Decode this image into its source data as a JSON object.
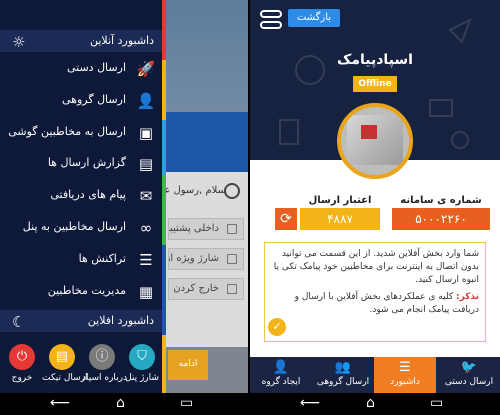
{
  "left": {
    "background": {
      "greeting": "سلام ,رسول عزیز",
      "rows": [
        "داخلی پشتیبانی",
        "شارژ ویژه از",
        "خارج کردن"
      ],
      "orange_button": "ادامه"
    },
    "online_header": "داشبورد آنلاین",
    "offline_header": "داشبورد افلاین",
    "menu": [
      {
        "label": "ارسال دستی",
        "icon": "rocket-icon",
        "glyph": "🚀"
      },
      {
        "label": "ارسال گروهی",
        "icon": "person-icon",
        "glyph": "👤"
      },
      {
        "label": "ارسال به مخاطبین گوشی",
        "icon": "contact-card-icon",
        "glyph": "▣"
      },
      {
        "label": "گزارش ارسال ها",
        "icon": "report-icon",
        "glyph": "▤"
      },
      {
        "label": "پیام های دریافتی",
        "icon": "envelope-icon",
        "glyph": "✉"
      },
      {
        "label": "ارسال مخاطبین به پنل",
        "icon": "infinity-icon",
        "glyph": "∞"
      },
      {
        "label": "تراکنش ها",
        "icon": "list-icon",
        "glyph": "☰"
      },
      {
        "label": "مدیریت مخاطبین",
        "icon": "document-icon",
        "glyph": "▦"
      }
    ],
    "bottom": [
      {
        "label": "شارژ پنل",
        "icon": "bag-icon",
        "color": "#27a9c4",
        "glyph": "⛉"
      },
      {
        "label": "درباره اسپاد",
        "icon": "info-icon",
        "color": "#7a7a7a",
        "glyph": "ⓘ"
      },
      {
        "label": "ارسال تیکت",
        "icon": "ticket-icon",
        "color": "#f2b418",
        "glyph": "▤"
      },
      {
        "label": "خروج",
        "icon": "power-icon",
        "color": "#e53935",
        "glyph": "⏻"
      }
    ],
    "strip_colors": [
      "#e53935",
      "#f2b418",
      "#2e9fe0",
      "#43b649",
      "#1e57a8",
      "#f2b418"
    ]
  },
  "right": {
    "back_label": "بازگشت",
    "title": "اسپادپیامک",
    "status": "Offline",
    "stats": [
      {
        "label": "شماره ی سامانه",
        "value": "۵۰۰۰۲۲۶۰",
        "color": "#e8601f"
      },
      {
        "label": "اعتبار ارسال",
        "value": "۴۸۸۷",
        "color": "#f2b418"
      }
    ],
    "notice_text": "شما وارد بخش آفلاین شدید. از این قسمت می توانید بدون اتصال به اینترنت برای مخاطبین خود پیامک تکی یا انبوه ارسال کنید.",
    "notice_warn_label": "تذکر:",
    "notice_warn_text": "کلیه ی عملکردهای بخش آفلاین با ارسال و دریافت پیامک انجام می شود.",
    "tabs": [
      {
        "label": "ایجاد گروه",
        "icon": "person-add-icon",
        "glyph": "👤"
      },
      {
        "label": "ارسال گروهی",
        "icon": "group-icon",
        "glyph": "👥"
      },
      {
        "label": "داشبورد",
        "icon": "dashboard-icon",
        "glyph": "☰"
      },
      {
        "label": "ارسال دستی",
        "icon": "twitter-bird-icon",
        "glyph": "🐦"
      }
    ]
  }
}
